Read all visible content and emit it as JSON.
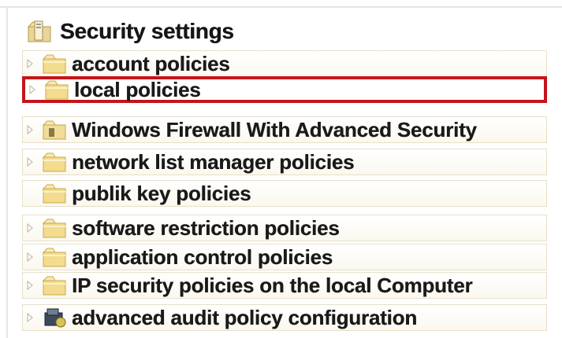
{
  "tree": {
    "root": {
      "label": "Security settings",
      "icon": "security-settings-icon"
    },
    "items": [
      {
        "label": "account policies",
        "icon": "folder-icon",
        "expandable": true,
        "selected": false
      },
      {
        "label": "local policies",
        "icon": "folder-icon",
        "expandable": true,
        "selected": true
      },
      {
        "label": "Windows Firewall With Advanced Security",
        "icon": "firewall-folder-icon",
        "expandable": true,
        "selected": false
      },
      {
        "label": "network list manager policies",
        "icon": "folder-icon",
        "expandable": true,
        "selected": false
      },
      {
        "label": "publik key policies",
        "icon": "folder-icon",
        "expandable": false,
        "selected": false
      },
      {
        "label": "software restriction policies",
        "icon": "folder-icon",
        "expandable": true,
        "selected": false
      },
      {
        "label": "application control policies",
        "icon": "folder-icon",
        "expandable": true,
        "selected": false
      },
      {
        "label": "IP security policies on the local Computer",
        "icon": "folder-icon",
        "expandable": true,
        "selected": false
      },
      {
        "label": "advanced audit policy configuration",
        "icon": "audit-policy-icon",
        "expandable": true,
        "selected": false
      }
    ]
  },
  "colors": {
    "selection_border": "#c4141c",
    "folder_fill": "#f3dc8e",
    "folder_edge": "#c9a94b",
    "row_border": "#e7dfc8"
  }
}
